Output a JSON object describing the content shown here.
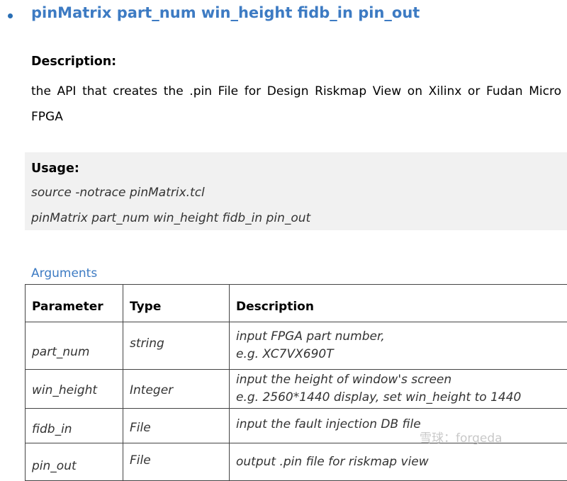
{
  "api": {
    "title": "pinMatrix part_num win_height fidb_in pin_out"
  },
  "description": {
    "heading": "Description:",
    "text": "the API that creates the .pin File for Design Riskmap View on Xilinx or Fudan Micro FPGA"
  },
  "usage": {
    "heading": "Usage:",
    "lines": [
      "source -notrace pinMatrix.tcl",
      "pinMatrix part_num win_height fidb_in pin_out"
    ]
  },
  "arguments": {
    "heading": "Arguments",
    "columns": [
      "Parameter",
      "Type",
      "Description"
    ],
    "rows": [
      {
        "parameter": "part_num",
        "type": "string",
        "description": [
          "input FPGA part number,",
          "e.g. XC7VX690T"
        ]
      },
      {
        "parameter": "win_height",
        "type": "Integer",
        "description": [
          "input the height of window's screen",
          "e.g. 2560*1440 display, set win_height to 1440"
        ]
      },
      {
        "parameter": "fidb_in",
        "type": "File",
        "description": [
          "input the fault injection DB file"
        ]
      },
      {
        "parameter": "pin_out",
        "type": "File",
        "description": [
          "output .pin file for riskmap view"
        ]
      }
    ]
  },
  "watermark": {
    "text": "雪球：forgeda"
  },
  "colors": {
    "title": "#3d7bc3",
    "usage_background": "#f1f1f1",
    "table_border": "#444444"
  }
}
